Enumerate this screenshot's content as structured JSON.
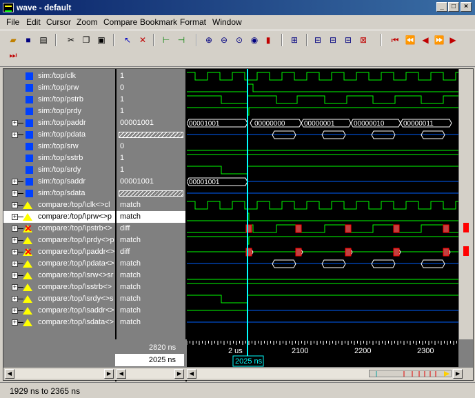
{
  "window": {
    "title": "wave - default"
  },
  "menu": [
    "File",
    "Edit",
    "Cursor",
    "Zoom",
    "Compare",
    "Bookmark",
    "Format",
    "Window"
  ],
  "signals": [
    {
      "name": "sim:/top/clk",
      "value": "1",
      "kind": "sig"
    },
    {
      "name": "sim:/top/prw",
      "value": "0",
      "kind": "sig"
    },
    {
      "name": "sim:/top/pstrb",
      "value": "1",
      "kind": "sig"
    },
    {
      "name": "sim:/top/prdy",
      "value": "1",
      "kind": "sig"
    },
    {
      "name": "sim:/top/paddr",
      "value": "00001001",
      "kind": "bus"
    },
    {
      "name": "sim:/top/pdata",
      "value": "",
      "kind": "bus",
      "hatched": true
    },
    {
      "name": "sim:/top/srw",
      "value": "0",
      "kind": "sig"
    },
    {
      "name": "sim:/top/sstrb",
      "value": "1",
      "kind": "sig"
    },
    {
      "name": "sim:/top/srdy",
      "value": "1",
      "kind": "sig"
    },
    {
      "name": "sim:/top/saddr",
      "value": "00001001",
      "kind": "bus"
    },
    {
      "name": "sim:/top/sdata",
      "value": "",
      "kind": "bus",
      "hatched": true
    },
    {
      "name": "compare:/top/\\clk<>cl",
      "value": "match",
      "kind": "cmp"
    },
    {
      "name": "compare:/top/\\prw<>p",
      "value": "match",
      "kind": "cmp",
      "selected": true
    },
    {
      "name": "compare:/top/\\pstrb<>",
      "value": "diff",
      "kind": "cmpx"
    },
    {
      "name": "compare:/top/\\prdy<>p",
      "value": "match",
      "kind": "cmp"
    },
    {
      "name": "compare:/top/\\paddr<>",
      "value": "diff",
      "kind": "cmpx"
    },
    {
      "name": "compare:/top/\\pdata<>",
      "value": "match",
      "kind": "cmp"
    },
    {
      "name": "compare:/top/\\srw<>sr",
      "value": "match",
      "kind": "cmp"
    },
    {
      "name": "compare:/top/\\sstrb<>",
      "value": "match",
      "kind": "cmp"
    },
    {
      "name": "compare:/top/\\srdy<>s",
      "value": "match",
      "kind": "cmp"
    },
    {
      "name": "compare:/top/\\saddr<>",
      "value": "match",
      "kind": "cmp"
    },
    {
      "name": "compare:/top/\\sdata<>",
      "value": "match",
      "kind": "cmp"
    }
  ],
  "bus_labels": {
    "paddr": [
      "00001001",
      "00000000",
      "00000001",
      "00000010",
      "00000011"
    ],
    "saddr": [
      "00001001"
    ]
  },
  "cursor": {
    "now_label": "2820 ns",
    "cursor_label": "2025 ns",
    "ruler_ticks": [
      "2 us",
      "2100",
      "2200",
      "2300"
    ],
    "cursor_marker": "2025 ns"
  },
  "colors": {
    "wave": "#00ff00",
    "bus": "#ffffff",
    "cursor": "#00ffff",
    "diff": "#ff0000"
  },
  "status": {
    "text": "1929 ns to 2365 ns"
  }
}
